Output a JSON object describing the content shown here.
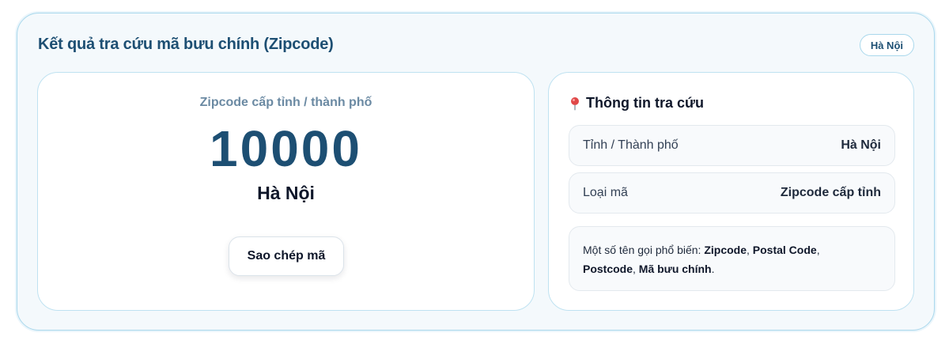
{
  "header": {
    "title": "Kết quả tra cứu mã bưu chính (Zipcode)",
    "badge": "Hà Nội"
  },
  "result": {
    "label": "Zipcode cấp tỉnh / thành phố",
    "code": "10000",
    "city": "Hà Nội",
    "copy_button_label": "Sao chép mã"
  },
  "info": {
    "icon": "map-pin-icon",
    "title": "Thông tin tra cứu",
    "rows": [
      {
        "label": "Tỉnh / Thành phố",
        "value": "Hà Nội"
      },
      {
        "label": "Loại mã",
        "value": "Zipcode cấp tỉnh"
      }
    ],
    "common_names": {
      "prefix": "Một số tên gọi phổ biến: ",
      "names": [
        "Zipcode",
        "Postal Code",
        "Postcode",
        "Mã bưu chính"
      ],
      "sep": ", ",
      "suffix": "."
    }
  },
  "colors": {
    "accent": "#1d4f73",
    "border": "#a9d8ec",
    "pin": "#e04848"
  }
}
